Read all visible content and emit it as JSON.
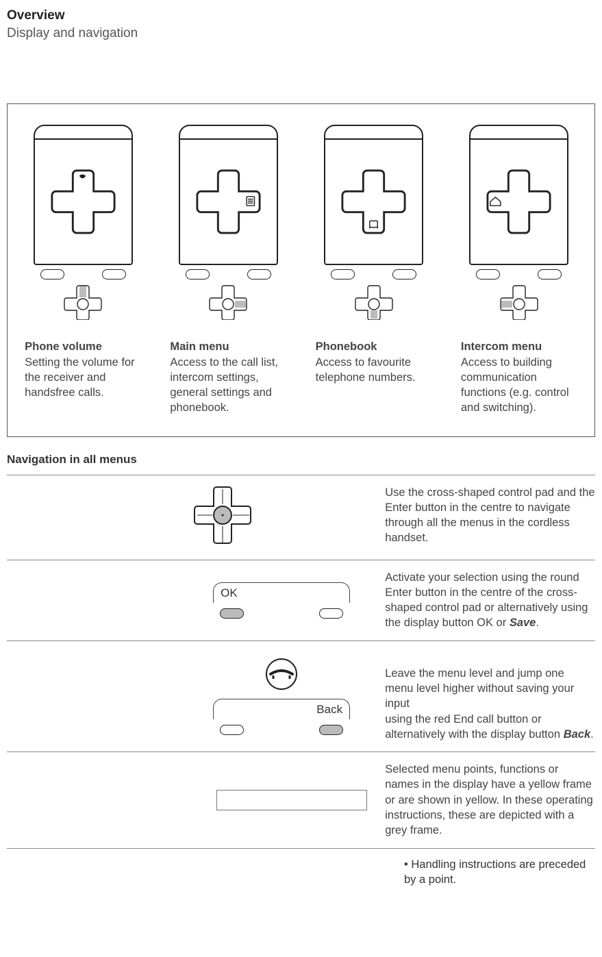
{
  "header": {
    "title": "Overview",
    "subtitle": "Display and navigation"
  },
  "phones": [
    {
      "title": "Phone volume",
      "desc": "Setting the volume for the receiver and handsfree calls.",
      "direction": "up"
    },
    {
      "title": "Main menu",
      "desc": "Access to the call list, intercom settings, general settings and phonebook.",
      "direction": "right"
    },
    {
      "title": "Phonebook",
      "desc": "Access to favourite telephone numbers.",
      "direction": "down"
    },
    {
      "title": "Intercom menu",
      "desc": "Access to building communication functions (e.g. control and switching).",
      "direction": "left"
    }
  ],
  "nav_heading": "Navigation in all menus",
  "nav": {
    "row1": "Use the cross-shaped control pad and the Enter button in the centre to navigate through all the menus in the cordless handset.",
    "row2_pre": "Activate your selection using the round Enter button in the centre of the cross-shaped control pad or alternatively using the display button OK or ",
    "row2_bold": "Save",
    "row2_post": ".",
    "ok_label": "OK",
    "row3_pre": "Leave the menu level and jump one menu level higher without saving your input\nusing the red End call button or alternatively with the display button ",
    "row3_bold": "Back",
    "row3_post": ".",
    "back_label": "Back",
    "row4": "Selected menu points, functions or names in the display have a yellow frame or are shown in yellow. In these operating instructions, these are depicted with a grey frame."
  },
  "footer_note": "• Handling instructions are preceded by a point."
}
